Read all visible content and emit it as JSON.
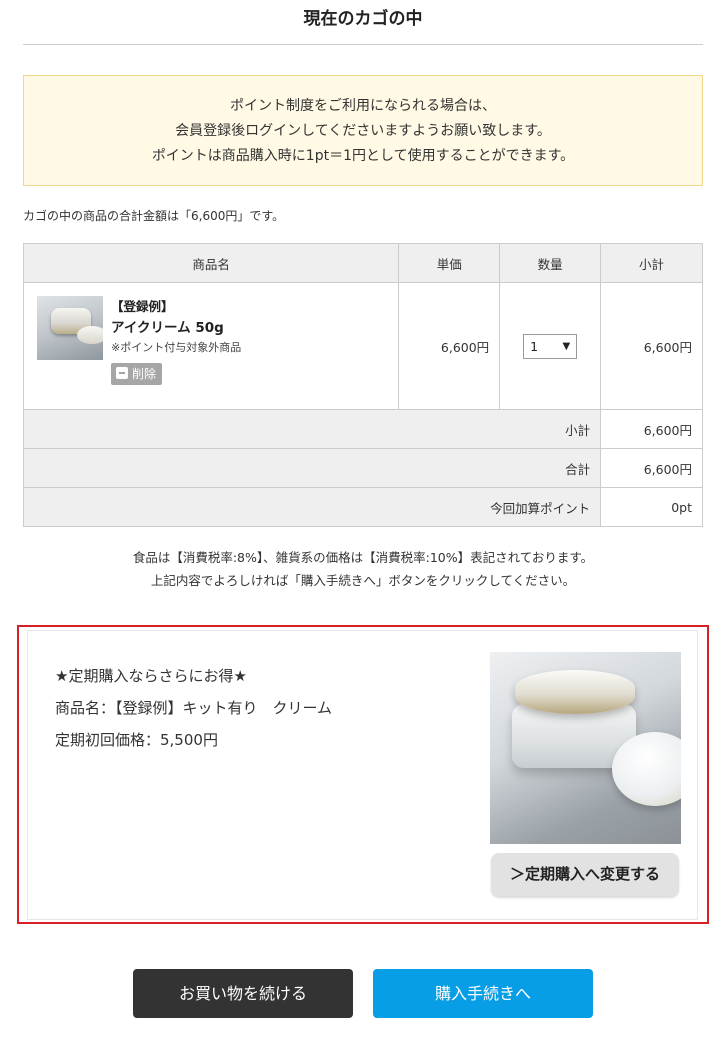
{
  "page_title": "現在のカゴの中",
  "notice": {
    "line1": "ポイント制度をご利用になられる場合は、",
    "line2": "会員登録後ログインしてくださいますようお願い致します。",
    "line3": "ポイントは商品購入時に1pt＝1円として使用することができます。"
  },
  "total_note": "カゴの中の商品の合計金額は「6,600円」です。",
  "table": {
    "headers": {
      "name": "商品名",
      "price": "単価",
      "qty": "数量",
      "subtotal": "小計"
    },
    "items": [
      {
        "tag": "【登録例】",
        "name": "アイクリーム 50g",
        "note": "※ポイント付与対象外商品",
        "delete_label": "削除",
        "unit_price": "6,600円",
        "qty": "1",
        "subtotal": "6,600円"
      }
    ],
    "summary": {
      "subtotal_label": "小計",
      "subtotal_value": "6,600円",
      "total_label": "合計",
      "total_value": "6,600円",
      "points_label": "今回加算ポイント",
      "points_value": "0pt"
    }
  },
  "tax_note": {
    "line1": "食品は【消費税率:8%】、雑貨系の価格は【消費税率:10%】表記されております。",
    "line2": "上記内容でよろしければ「購入手続きへ」ボタンをクリックしてください。"
  },
  "promo": {
    "headline": "★定期購入ならさらにお得★",
    "product": "商品名：【登録例】キット有り　クリーム",
    "price": "定期初回価格：5,500円",
    "button_label": "＞定期購入へ変更する"
  },
  "buttons": {
    "continue": "お買い物を続ける",
    "checkout": "購入手続きへ"
  },
  "colors": {
    "accent": "#089ee5",
    "promo_border": "#d81f26",
    "notice_bg": "#fff9e5"
  }
}
